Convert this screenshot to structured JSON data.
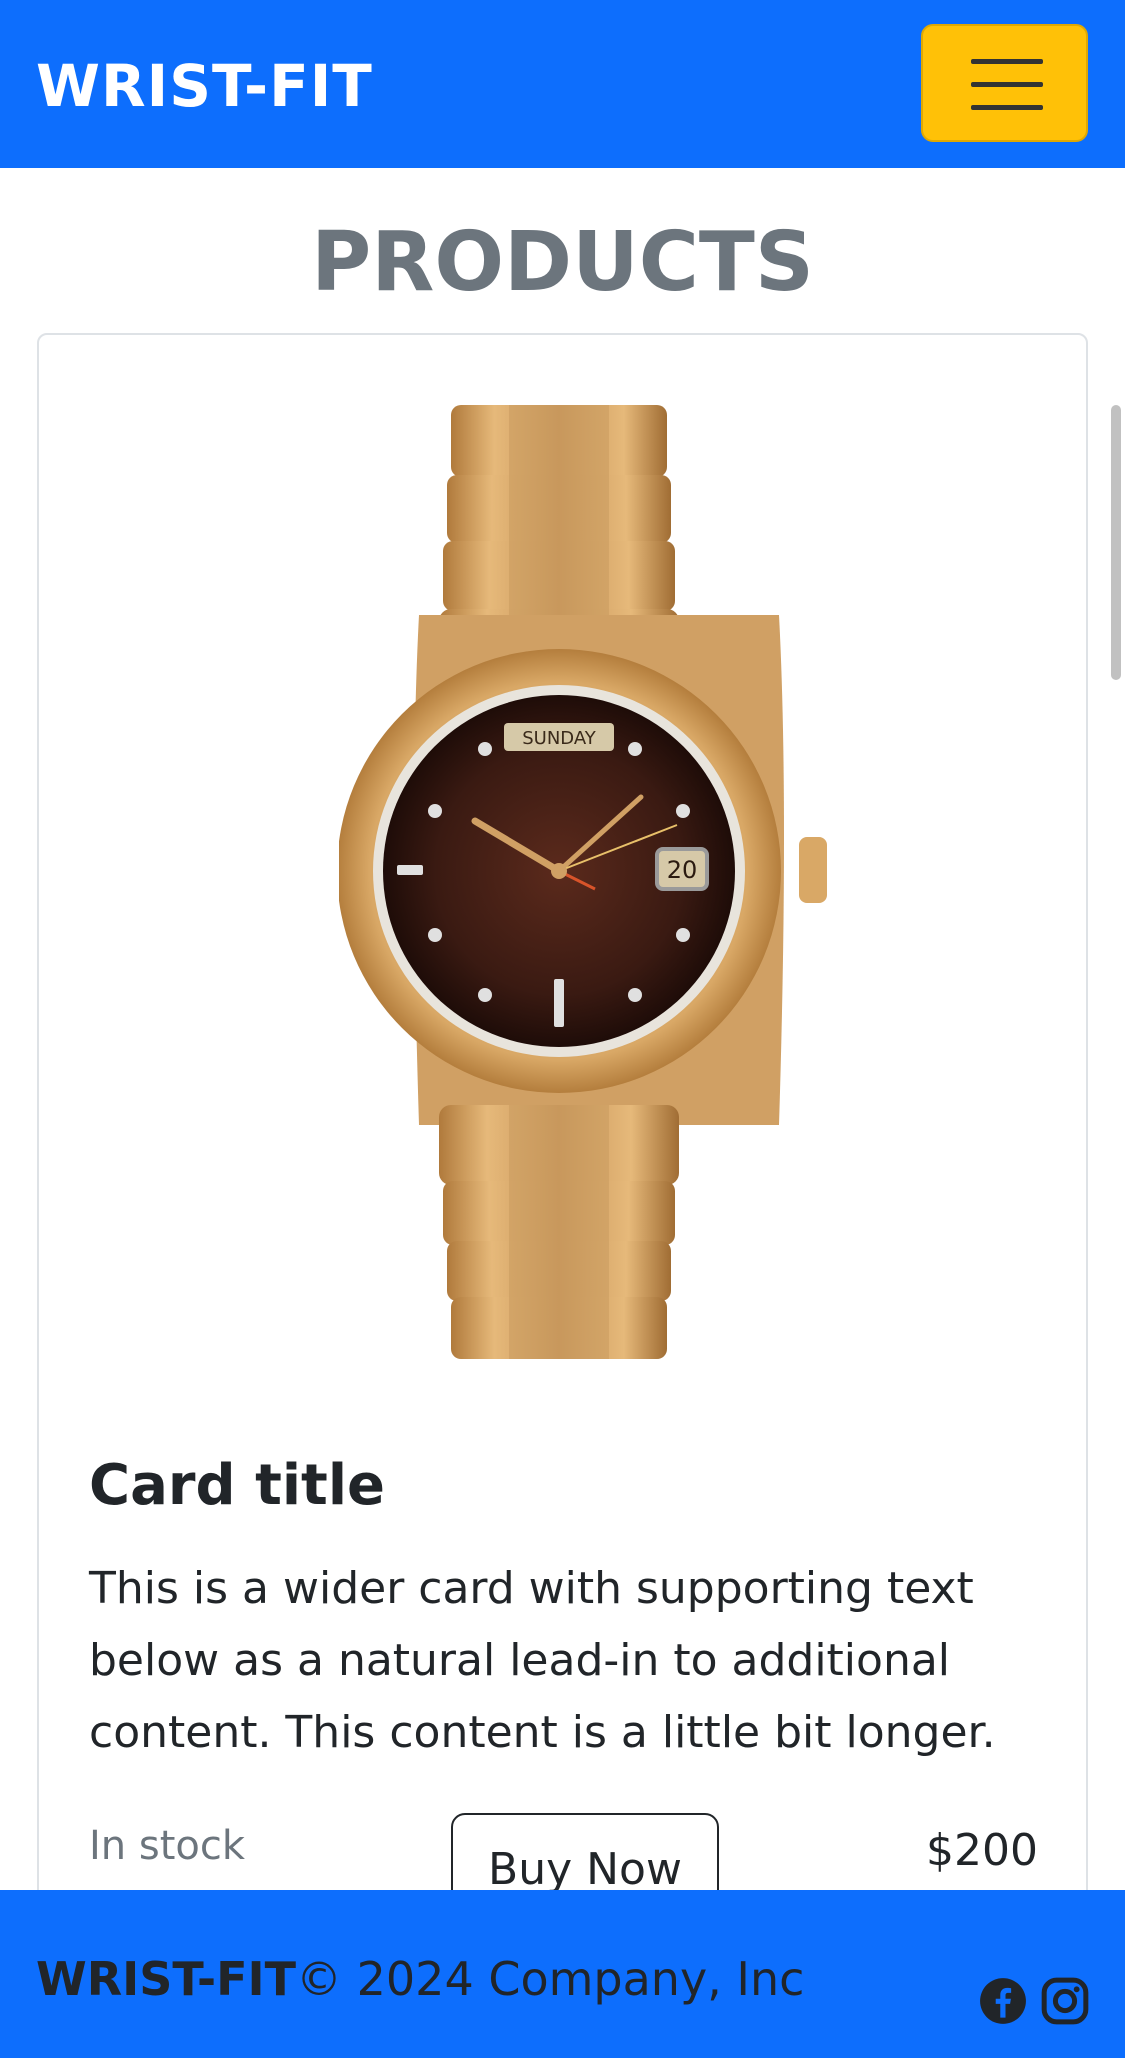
{
  "navbar": {
    "brand": "WRIST-FIT",
    "toggler_icon": "menu-icon"
  },
  "page": {
    "heading": "PRODUCTS"
  },
  "card": {
    "image_alt": "gold watch",
    "watch_day": "SUNDAY",
    "watch_date": "20",
    "title": "Card title",
    "text": "This is a wider card with supporting text below as a natural lead-in to additional content. This content is a little bit longer.",
    "stock": "In stock",
    "buy_label": "Buy Now",
    "price": "$200"
  },
  "footer": {
    "brand": "WRIST-FIT",
    "copyright": "© 2024 Company, Inc",
    "icons": [
      "facebook-icon",
      "instagram-icon"
    ]
  },
  "colors": {
    "primary": "#0d6efd",
    "warning": "#ffc107",
    "muted": "#6c757d"
  }
}
